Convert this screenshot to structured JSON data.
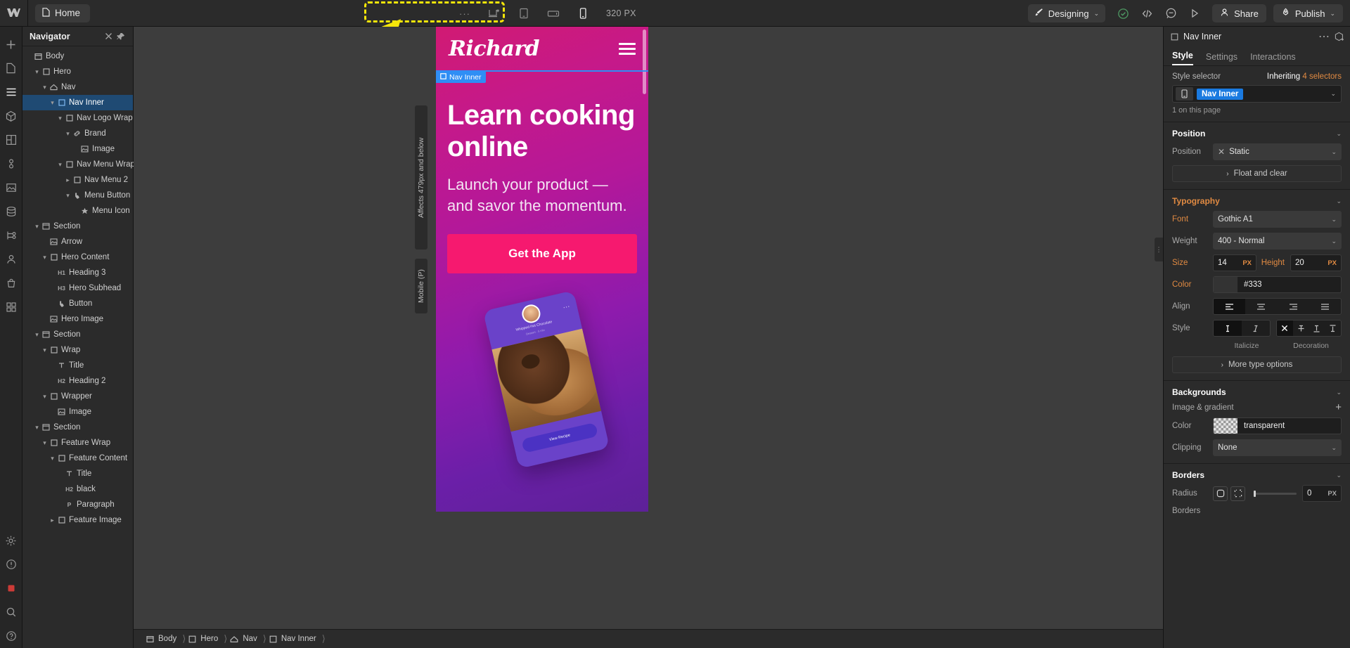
{
  "topbar": {
    "logo_icon": "webflow-logo-icon",
    "page_chip": {
      "icon": "page-icon",
      "label": "Home"
    },
    "device_bar": {
      "more_label": "···",
      "devices": [
        {
          "name": "desktop-breakpoint",
          "icon": "desktop-asterisk-icon"
        },
        {
          "name": "tablet-breakpoint",
          "icon": "tablet-icon"
        },
        {
          "name": "mobile-landscape-breakpoint",
          "icon": "mobile-landscape-icon"
        },
        {
          "name": "mobile-portrait-breakpoint",
          "icon": "mobile-portrait-icon",
          "active": true
        }
      ],
      "px_label": "320 PX"
    },
    "designing": {
      "icon": "brush-icon",
      "label": "Designing",
      "caret": "⌄"
    },
    "status_icons": [
      {
        "name": "checkmark-circle-icon"
      },
      {
        "name": "code-icon"
      },
      {
        "name": "comment-icon"
      },
      {
        "name": "preview-play-icon"
      }
    ],
    "share": {
      "icon": "person-icon",
      "label": "Share"
    },
    "publish": {
      "icon": "rocket-icon",
      "label": "Publish",
      "caret": "⌄"
    }
  },
  "left_rail": [
    {
      "name": "add-element-icon",
      "glyph": "+"
    },
    {
      "name": "pages-icon",
      "glyph": "□"
    },
    {
      "name": "navigator-icon",
      "glyph": "≡",
      "active": true
    },
    {
      "name": "components-icon",
      "glyph": "⬡"
    },
    {
      "name": "style-manager-icon",
      "glyph": "◧"
    },
    {
      "name": "variables-icon",
      "glyph": "⚖"
    },
    {
      "name": "assets-icon",
      "glyph": "◱"
    },
    {
      "name": "cms-icon",
      "glyph": "⛁"
    },
    {
      "name": "logic-icon",
      "glyph": "⚡"
    },
    {
      "name": "users-icon",
      "glyph": "⚹"
    },
    {
      "name": "ecommerce-icon",
      "glyph": "⛃"
    },
    {
      "name": "apps-icon",
      "glyph": "⊞"
    },
    {
      "name": "settings-gear-icon",
      "glyph": "⚙"
    },
    {
      "name": "audit-icon",
      "glyph": "◎"
    },
    {
      "name": "video-record-icon",
      "glyph": "■"
    },
    {
      "name": "search-icon",
      "glyph": "⌕"
    },
    {
      "name": "help-icon",
      "glyph": "?"
    }
  ],
  "navigator": {
    "title": "Navigator",
    "close_icon": "close-icon",
    "pin_icon": "pin-icon",
    "tree": [
      {
        "label": "Body",
        "depth": 0,
        "icon": "body-icon",
        "caret": ""
      },
      {
        "label": "Hero",
        "depth": 1,
        "icon": "div-icon",
        "caret": "down"
      },
      {
        "label": "Nav",
        "depth": 2,
        "icon": "nav-icon",
        "caret": "down"
      },
      {
        "label": "Nav Inner",
        "depth": 3,
        "icon": "div-icon",
        "caret": "down",
        "selected": true
      },
      {
        "label": "Nav Logo Wrap",
        "depth": 4,
        "icon": "div-icon",
        "caret": "down"
      },
      {
        "label": "Brand",
        "depth": 5,
        "icon": "link-icon",
        "caret": "down"
      },
      {
        "label": "Image",
        "depth": 6,
        "icon": "image-icon",
        "caret": ""
      },
      {
        "label": "Nav Menu Wrap",
        "depth": 4,
        "icon": "div-icon",
        "caret": "down"
      },
      {
        "label": "Nav Menu 2",
        "depth": 5,
        "icon": "div-icon",
        "caret": "right"
      },
      {
        "label": "Menu Button",
        "depth": 5,
        "icon": "button-icon",
        "caret": "down"
      },
      {
        "label": "Menu Icon",
        "depth": 6,
        "icon": "star-icon",
        "caret": ""
      },
      {
        "label": "Section",
        "depth": 1,
        "icon": "section-icon",
        "caret": "down"
      },
      {
        "label": "Arrow",
        "depth": 2,
        "icon": "image-icon",
        "caret": ""
      },
      {
        "label": "Hero Content",
        "depth": 2,
        "icon": "div-icon",
        "caret": "down"
      },
      {
        "label": "Heading 3",
        "depth": 3,
        "icon": "h1-icon",
        "caret": ""
      },
      {
        "label": "Hero Subhead",
        "depth": 3,
        "icon": "h3-icon",
        "caret": ""
      },
      {
        "label": "Button",
        "depth": 3,
        "icon": "button-icon",
        "caret": ""
      },
      {
        "label": "Hero Image",
        "depth": 2,
        "icon": "image-icon",
        "caret": ""
      },
      {
        "label": "Section",
        "depth": 1,
        "icon": "section-icon",
        "caret": "down"
      },
      {
        "label": "Wrap",
        "depth": 2,
        "icon": "div-icon",
        "caret": "down"
      },
      {
        "label": "Title",
        "depth": 3,
        "icon": "text-icon",
        "caret": ""
      },
      {
        "label": "Heading 2",
        "depth": 3,
        "icon": "h2-icon",
        "caret": ""
      },
      {
        "label": "Wrapper",
        "depth": 2,
        "icon": "div-icon",
        "caret": "down"
      },
      {
        "label": "Image",
        "depth": 3,
        "icon": "image-icon",
        "caret": ""
      },
      {
        "label": "Section",
        "depth": 1,
        "icon": "section-icon",
        "caret": "down"
      },
      {
        "label": "Feature Wrap",
        "depth": 2,
        "icon": "div-icon",
        "caret": "down"
      },
      {
        "label": "Feature Content",
        "depth": 3,
        "icon": "div-icon",
        "caret": "down"
      },
      {
        "label": "Title",
        "depth": 4,
        "icon": "text-icon",
        "caret": ""
      },
      {
        "label": "black",
        "depth": 4,
        "icon": "h2-icon",
        "caret": ""
      },
      {
        "label": "Paragraph",
        "depth": 4,
        "icon": "p-icon",
        "caret": ""
      },
      {
        "label": "Feature Image",
        "depth": 3,
        "icon": "div-icon",
        "caret": "right"
      }
    ]
  },
  "canvas": {
    "vertical_labels": [
      "Affects 479px and below",
      "Mobile (P)"
    ],
    "selected_badge": {
      "icon": "div-icon",
      "label": "Nav Inner"
    },
    "phone": {
      "logo": "Richard",
      "menu_icon": "hamburger-icon",
      "heading": "Learn cooking online",
      "subhead": "Launch your product — and savor the momentum.",
      "button": "Get the App",
      "card": {
        "title": "Whipped Hot Chocolate",
        "subtitle": "Dessert · 5 min",
        "dots_icon": "more-dots-icon",
        "button": "View Recipe"
      }
    },
    "breadcrumb": [
      {
        "icon": "body-icon",
        "label": "Body"
      },
      {
        "icon": "div-icon",
        "label": "Hero"
      },
      {
        "icon": "nav-icon",
        "label": "Nav"
      },
      {
        "icon": "div-icon",
        "label": "Nav Inner"
      }
    ]
  },
  "style_panel": {
    "element": {
      "icon": "div-icon",
      "label": "Nav Inner"
    },
    "more_icon": "more-dots-icon",
    "component_icon": "create-component-icon",
    "tabs": [
      {
        "label": "Style",
        "active": true
      },
      {
        "label": "Settings",
        "active": false
      },
      {
        "label": "Interactions",
        "active": false
      }
    ],
    "selector": {
      "label": "Style selector",
      "inheriting_prefix": "Inheriting",
      "inheriting_count": "4 selectors",
      "device_icon": "mobile-portrait-icon",
      "value": "Nav Inner",
      "caret": "⌄",
      "note": "1 on this page"
    },
    "position": {
      "title": "Position",
      "caret": "⌄",
      "row_label": "Position",
      "clear_icon": "x-icon",
      "value": "Static",
      "value_caret": "⌄",
      "float_and_clear": "Float and clear",
      "float_caret": "›"
    },
    "typography": {
      "title": "Typography",
      "caret": "⌄",
      "font_label": "Font",
      "font_value": "Gothic A1",
      "weight_label": "Weight",
      "weight_value": "400 - Normal",
      "size_label": "Size",
      "size_value": "14",
      "size_unit": "PX",
      "height_label": "Height",
      "height_value": "20",
      "height_unit": "PX",
      "color_label": "Color",
      "color_value": "#333",
      "color_hex": "#333333",
      "align_label": "Align",
      "align_options": [
        "align-left-icon",
        "align-center-icon",
        "align-right-icon",
        "align-justify-icon"
      ],
      "align_selected": 0,
      "style_label": "Style",
      "italicize_label": "Italicize",
      "decoration_label": "Decoration",
      "more_type_options": "More type options",
      "more_caret": "›"
    },
    "backgrounds": {
      "title": "Backgrounds",
      "caret": "⌄",
      "image_gradient_label": "Image & gradient",
      "add_icon": "plus-icon",
      "color_label": "Color",
      "color_value": "transparent",
      "clipping_label": "Clipping",
      "clipping_value": "None",
      "clipping_caret": "⌄"
    },
    "borders": {
      "title": "Borders",
      "caret": "⌄",
      "radius_label": "Radius",
      "radius_value": "0",
      "radius_unit": "PX",
      "borders_label": "Borders"
    }
  },
  "colors": {
    "accent_blue": "#1a7ae0",
    "highlight_orange": "#e08a42",
    "annotation_yellow": "#f5e60a",
    "pink": "#f6196f",
    "panel_bg": "#2b2b2b",
    "canvas_bg": "#3d3d3d"
  }
}
